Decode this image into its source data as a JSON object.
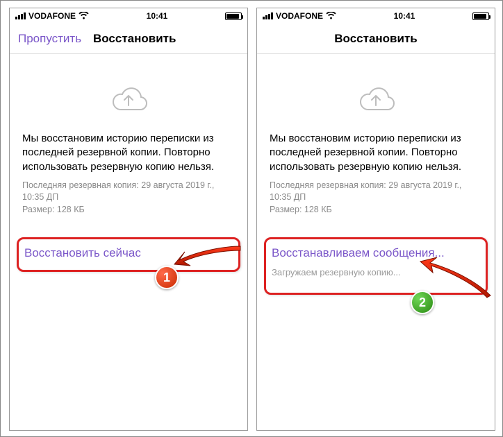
{
  "statusBar": {
    "carrier": "VODAFONE",
    "time": "10:41"
  },
  "left": {
    "nav": {
      "skip": "Пропустить",
      "title": "Восстановить"
    },
    "mainText": "Мы восстановим историю переписки из последней резервной копии. Повторно использовать резервную копию нельзя.",
    "backupLine": "Последняя резервная копия: 29 августа 2019 г., 10:35 ДП",
    "sizeLine": "Размер: 128 КБ",
    "action": "Восстановить сейчас"
  },
  "right": {
    "nav": {
      "title": "Восстановить"
    },
    "mainText": "Мы восстановим историю переписки из последней резервной копии. Повторно использовать резервную копию нельзя.",
    "backupLine": "Последняя резервная копия: 29 августа 2019 г., 10:35 ДП",
    "sizeLine": "Размер: 128 КБ",
    "action": "Восстанавливаем сообщения...",
    "subStatus": "Загружаем резервную копию..."
  },
  "badges": {
    "one": "1",
    "two": "2"
  }
}
